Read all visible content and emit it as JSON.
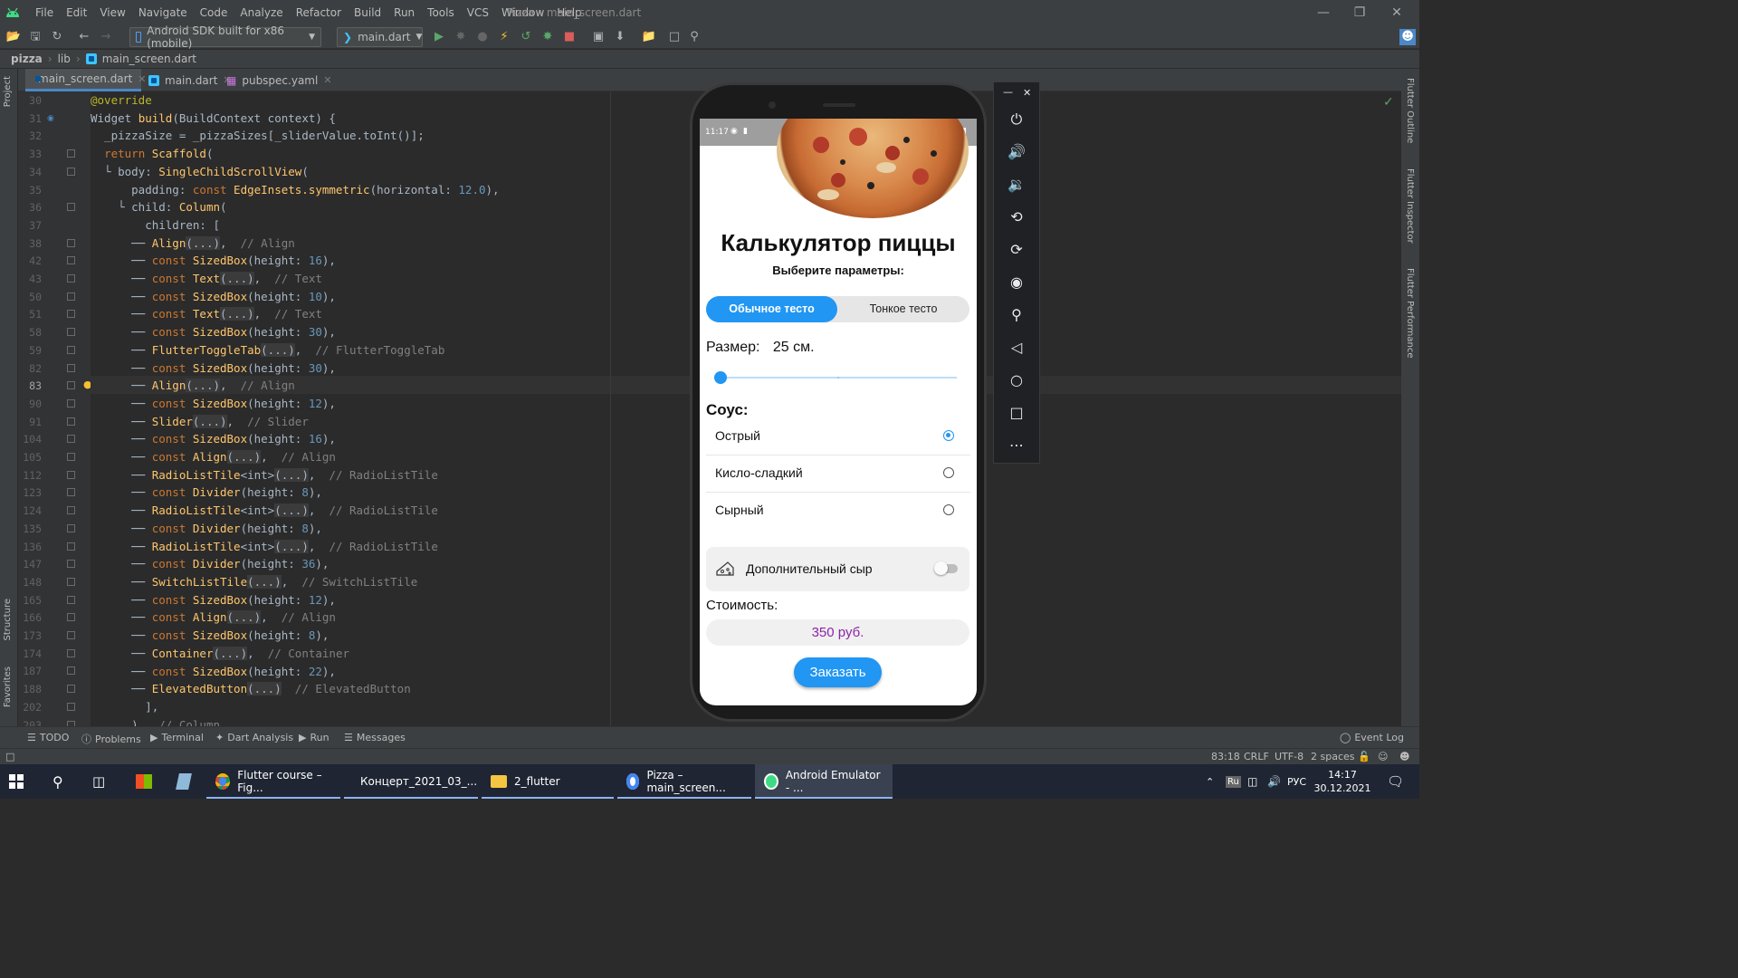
{
  "menubar": {
    "items": [
      "File",
      "Edit",
      "View",
      "Navigate",
      "Code",
      "Analyze",
      "Refactor",
      "Build",
      "Run",
      "Tools",
      "VCS",
      "Window",
      "Help"
    ],
    "window_title": "Pizza – main_screen.dart"
  },
  "toolbar": {
    "device": "Android SDK built for x86 (mobile)",
    "run_config": "main.dart"
  },
  "breadcrumbs": [
    "pizza",
    "lib",
    "main_screen.dart"
  ],
  "left_strip": {
    "project": "Project",
    "structure": "Structure",
    "favorites": "Favorites"
  },
  "right_strip": {
    "outline": "Flutter Outline",
    "inspector": "Flutter Inspector",
    "performance": "Flutter Performance"
  },
  "tabs": [
    {
      "label": "main_screen.dart",
      "active": true
    },
    {
      "label": "main.dart",
      "active": false
    },
    {
      "label": "pubspec.yaml",
      "active": false
    }
  ],
  "editor": {
    "line_numbers": [
      "30",
      "31",
      "32",
      "33",
      "34",
      "35",
      "36",
      "37",
      "38",
      "42",
      "43",
      "50",
      "51",
      "58",
      "59",
      "82",
      "83",
      "90",
      "91",
      "104",
      "105",
      "112",
      "123",
      "124",
      "135",
      "136",
      "147",
      "148",
      "165",
      "166",
      "173",
      "174",
      "187",
      "188",
      "202",
      "203"
    ],
    "current_line": "83"
  },
  "bottom_tools": [
    "TODO",
    "Problems",
    "Terminal",
    "Dart Analysis",
    "Run",
    "Messages"
  ],
  "event_log": "Event Log",
  "status": {
    "position": "83:18",
    "line_sep": "CRLF",
    "encoding": "UTF-8",
    "indent": "2 spaces"
  },
  "taskbar": {
    "items": [
      "Flutter course – Fig...",
      "Концерт_2021_03_...",
      "2_flutter",
      "Pizza – main_screen...",
      "Android Emulator - ..."
    ],
    "lang_indicator": "Ru",
    "lang": "РУС",
    "time": "14:17",
    "date": "30.12.2021"
  },
  "app": {
    "status_time": "11:17",
    "title": "Калькулятор пиццы",
    "subtitle": "Выберите параметры:",
    "dough_options": [
      "Обычное тесто",
      "Тонкое тесто"
    ],
    "dough_selected": 0,
    "size_label": "Размер:",
    "size_value": "25 см.",
    "slider_value": 0,
    "sauce_label": "Соус:",
    "sauces": [
      "Острый",
      "Кисло-сладкий",
      "Сырный"
    ],
    "sauce_selected": 0,
    "extra_cheese_label": "Дополнительный сыр",
    "extra_cheese_on": false,
    "cost_label": "Стоимость:",
    "cost_value": "350 руб.",
    "order_button": "Заказать"
  },
  "colors": {
    "primary": "#2196f3",
    "price": "#8e24aa",
    "ide_bg": "#2b2b2b"
  }
}
